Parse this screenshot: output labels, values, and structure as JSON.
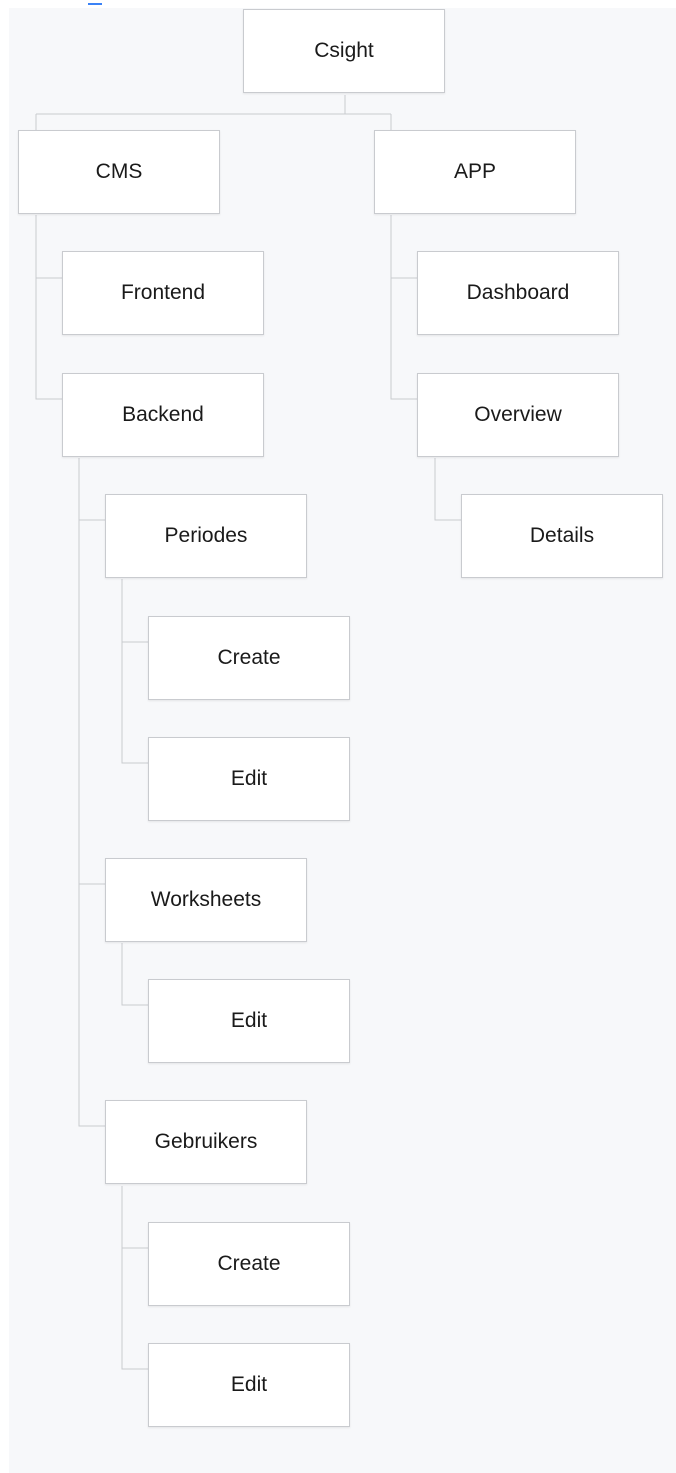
{
  "tree": {
    "root": "Csight",
    "cms": "CMS",
    "app": "APP",
    "frontend": "Frontend",
    "backend": "Backend",
    "periodes": "Periodes",
    "periodes_create": "Create",
    "periodes_edit": "Edit",
    "worksheets": "Worksheets",
    "worksheets_edit": "Edit",
    "gebruikers": "Gebruikers",
    "gebruikers_create": "Create",
    "gebruikers_edit": "Edit",
    "dashboard": "Dashboard",
    "overview": "Overview",
    "details": "Details"
  },
  "colors": {
    "background": "#f7f8fa",
    "node": "#ffffff",
    "border": "#c9cbcf",
    "text": "#1a1a1a",
    "link": "#3b82f6"
  }
}
